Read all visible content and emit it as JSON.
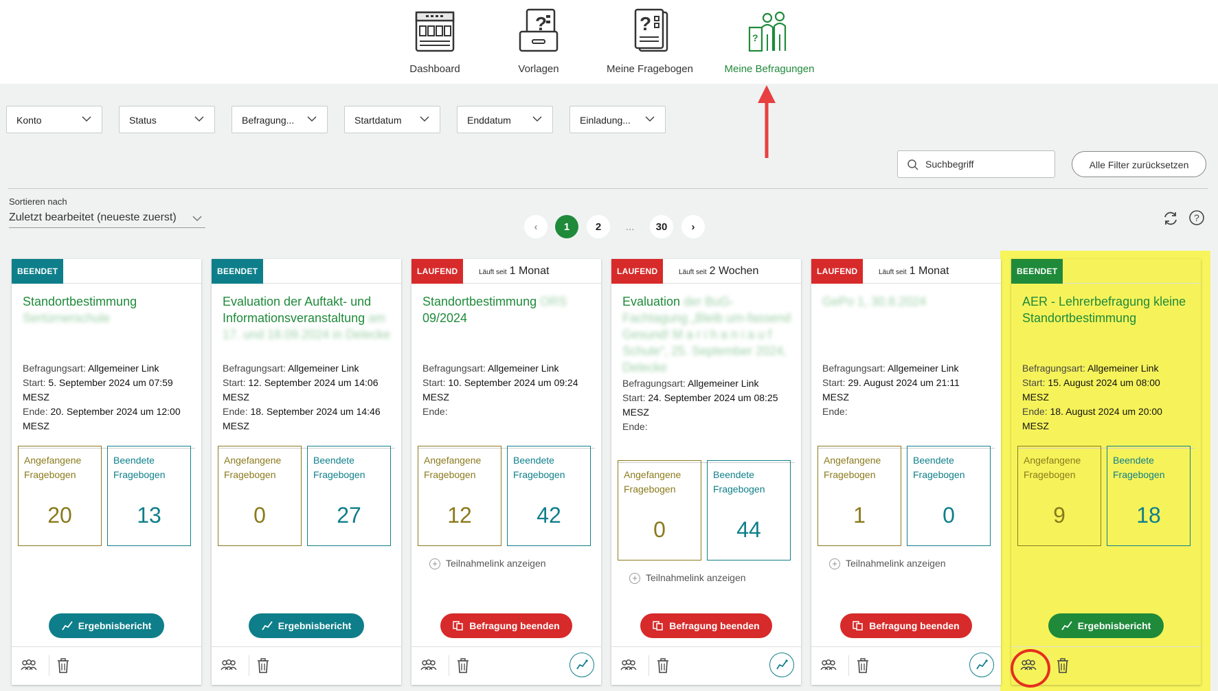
{
  "nav": {
    "items": [
      {
        "label": "Dashboard",
        "icon": "dashboard-icon"
      },
      {
        "label": "Vorlagen",
        "icon": "templates-icon"
      },
      {
        "label": "Meine Fragebogen",
        "icon": "questionnaires-icon"
      },
      {
        "label": "Meine Befragungen",
        "icon": "surveys-icon",
        "active": true
      }
    ]
  },
  "filters": {
    "konto": "Konto",
    "status": "Status",
    "befragung": "Befragung...",
    "startdatum": "Startdatum",
    "enddatum": "Enddatum",
    "einladung": "Einladung..."
  },
  "search": {
    "placeholder": "Suchbegriff"
  },
  "reset_label": "Alle Filter zurücksetzen",
  "sort": {
    "label": "Sortieren nach",
    "value": "Zuletzt bearbeitet (neueste zuerst)"
  },
  "pagination": {
    "prev": "‹",
    "pages": [
      "1",
      "2",
      "...",
      "30"
    ],
    "next": "›",
    "current": "1"
  },
  "colors": {
    "green": "#1f8a3a",
    "teal": "#0e7f8a",
    "red": "#d72a2a",
    "olive": "#8a7a1c",
    "highlight": "#f6f35a"
  },
  "labels": {
    "art": "Befragungsart:",
    "start": "Start:",
    "ende": "Ende:",
    "started": [
      "Angefangene",
      "Fragebogen"
    ],
    "finished": [
      "Beendete",
      "Fragebogen"
    ],
    "teilnahme": "Teilnahmelink anzeigen",
    "report": "Ergebnisbericht",
    "stop": "Befragung beenden",
    "since_small": "Läuft seit"
  },
  "cards": [
    {
      "status": "BEENDET",
      "since": "",
      "title": "Standortbestimmung",
      "title_blur": "Sertürnerschule",
      "art": "Allgemeiner Link",
      "start": "5. September 2024 um 07:59",
      "start_tz": "MESZ",
      "ende": "20. September 2024 um 12:00",
      "ende_tz": "MESZ",
      "started": "20",
      "finished": "13"
    },
    {
      "status": "BEENDET",
      "since": "",
      "title": "Evaluation der Auftakt- und Informationsveranstaltung",
      "title_blur": "am 17. und 18.09.2024 in Delecke",
      "art": "Allgemeiner Link",
      "start": "12. September 2024 um 14:06",
      "start_tz": "MESZ",
      "ende": "18. September 2024 um 14:46",
      "ende_tz": "MESZ",
      "started": "0",
      "finished": "27"
    },
    {
      "status": "LAUFEND",
      "since": "1 Monat",
      "title": "Standortbestimmung",
      "title_blur": "ORS",
      "title_end": "09/2024",
      "art": "Allgemeiner Link",
      "start": "10. September 2024 um 09:24",
      "start_tz": "MESZ",
      "ende": "",
      "ende_tz": "",
      "started": "12",
      "finished": "42"
    },
    {
      "status": "LAUFEND",
      "since": "2 Wochen",
      "title": "Evaluation",
      "title_blur": "der BuG-Fachtagung „Bleib um-fassend Gesund! M a r i h a n i a u f Schule“, 25. September 2024, Delecke",
      "art": "Allgemeiner Link",
      "start": "24. September 2024 um 08:25",
      "start_tz": "MESZ",
      "ende": "",
      "ende_tz": "",
      "started": "0",
      "finished": "44"
    },
    {
      "status": "LAUFEND",
      "since": "1 Monat",
      "title": "",
      "title_blur": "GePo 1, 30.8.2024",
      "art": "Allgemeiner Link",
      "start": "29. August 2024 um 21:11",
      "start_tz": "MESZ",
      "ende": "",
      "ende_tz": "",
      "started": "1",
      "finished": "0"
    },
    {
      "status": "BEENDET",
      "since": "",
      "title": "AER - Lehrerbefragung kleine Standortbestimmung",
      "title_blur": "",
      "art": "Allgemeiner Link",
      "start": "15. August 2024 um 08:00",
      "start_tz": "MESZ",
      "ende": "18. August 2024 um 20:00",
      "ende_tz": "MESZ",
      "started": "9",
      "finished": "18"
    }
  ]
}
